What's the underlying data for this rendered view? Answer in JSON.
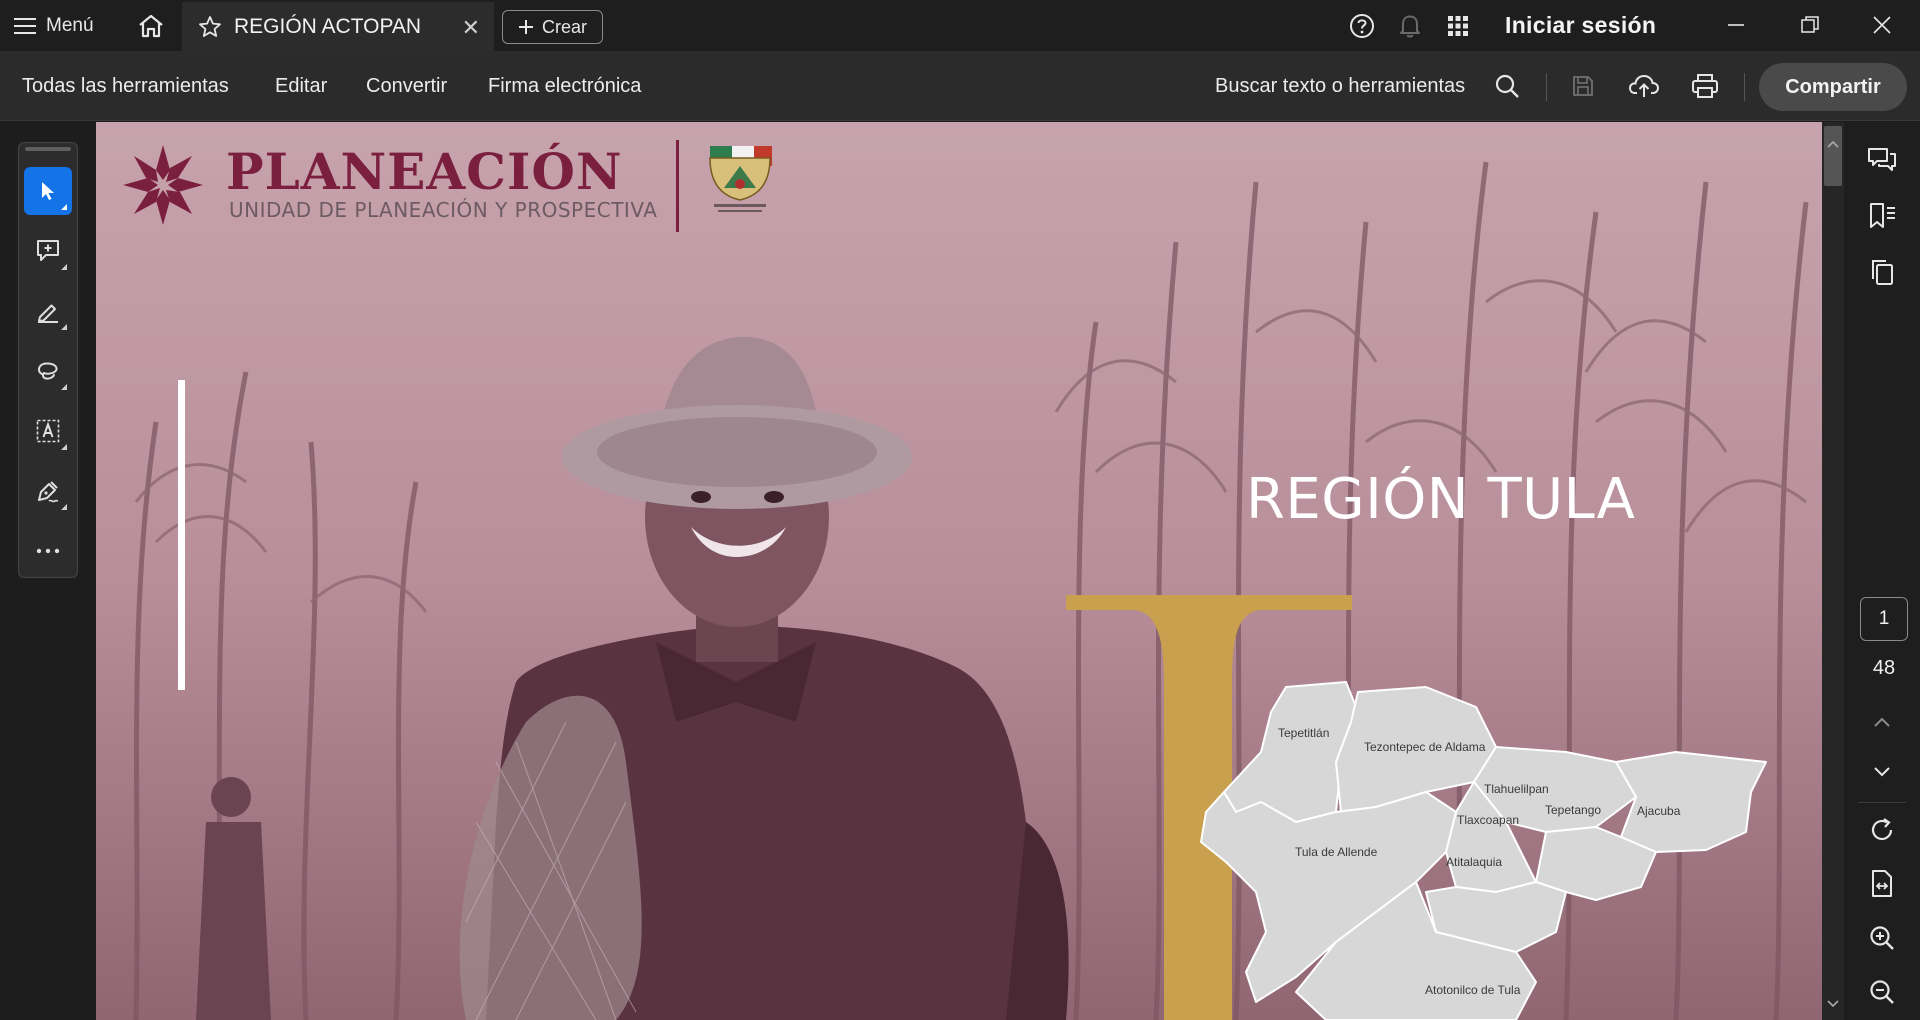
{
  "titlebar": {
    "menu_label": "Menú",
    "tab_title": "REGIÓN ACTOPAN",
    "create_label": "Crear",
    "signin_label": "Iniciar sesión"
  },
  "toolbar": {
    "menus": [
      "Todas las herramientas",
      "Editar",
      "Convertir",
      "Firma electrónica"
    ],
    "search_label": "Buscar texto o herramientas",
    "share_label": "Compartir"
  },
  "document": {
    "logo_title": "PLANEACIÓN",
    "logo_subtitle": "UNIDAD DE PLANEACIÓN Y PROSPECTIVA",
    "region_title": "REGIÓN TULA",
    "map_labels": [
      "Tepetitlán",
      "Tezontepec de Aldama",
      "Tlahuelilpan",
      "Tepetango",
      "Ajacuba",
      "Tlaxcoapan",
      "Tula de Allende",
      "Atitalaquia",
      "Atotonilco de Tula"
    ],
    "colors": {
      "background": "#b8909b",
      "accent_gold": "#c9a14e",
      "brand": "#7a1f3d",
      "map_fill": "#d7d7d7"
    }
  },
  "pagination": {
    "current_page": "1",
    "total_pages": "48"
  }
}
